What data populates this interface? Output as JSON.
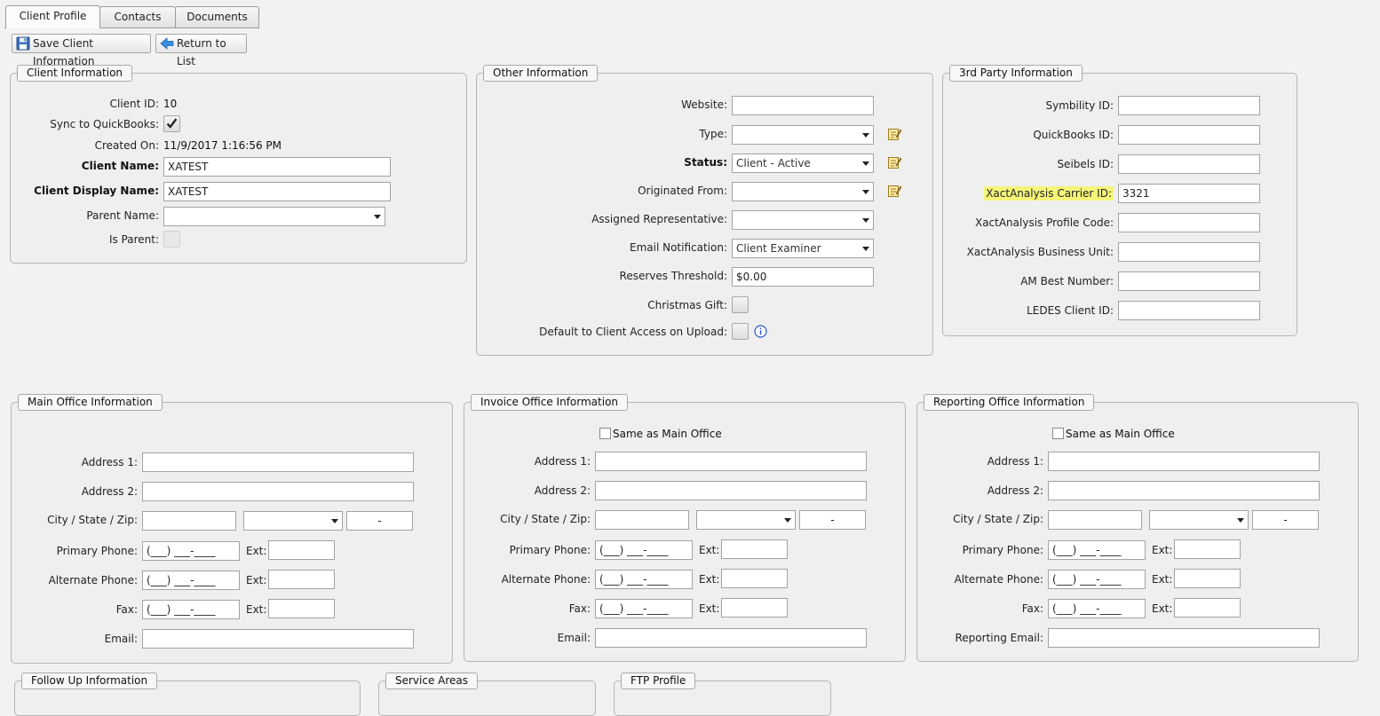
{
  "tabs": [
    {
      "label": "Client Profile",
      "active": true
    },
    {
      "label": "Contacts",
      "active": false
    },
    {
      "label": "Documents",
      "active": false
    }
  ],
  "toolbar": {
    "save_label": "Save Client Information",
    "return_label": "Return to List",
    "save_icon": "floppy-disk-icon",
    "return_icon": "back-arrow-icon"
  },
  "client_info": {
    "title": "Client Information",
    "client_id_label": "Client ID:",
    "client_id": "10",
    "sync_label": "Sync to QuickBooks:",
    "sync_checked": true,
    "created_label": "Created On:",
    "created_on": "11/9/2017 1:16:56 PM",
    "client_name_label": "Client Name:",
    "client_name": "XATEST",
    "display_name_label": "Client Display Name:",
    "display_name": "XATEST",
    "parent_label": "Parent Name:",
    "parent_value": "",
    "is_parent_label": "Is Parent:"
  },
  "other_info": {
    "title": "Other Information",
    "website_label": "Website:",
    "website": "",
    "type_label": "Type:",
    "type_value": "",
    "status_label": "Status:",
    "status_value": "Client - Active",
    "originated_label": "Originated From:",
    "originated_value": "",
    "rep_label": "Assigned Representative:",
    "rep_value": "",
    "email_notif_label": "Email Notification:",
    "email_notif_value": "Client Examiner",
    "reserves_label": "Reserves Threshold:",
    "reserves_value": "$0.00",
    "christmas_label": "Christmas Gift:",
    "default_access_label": "Default to Client Access on Upload:"
  },
  "third_party": {
    "title": "3rd Party Information",
    "fields": [
      {
        "label": "Symbility ID:",
        "value": "",
        "highlight": false
      },
      {
        "label": "QuickBooks ID:",
        "value": "",
        "highlight": false
      },
      {
        "label": "Seibels ID:",
        "value": "",
        "highlight": false
      },
      {
        "label": "XactAnalysis Carrier ID:",
        "value": "3321",
        "highlight": true
      },
      {
        "label": "XactAnalysis Profile Code:",
        "value": "",
        "highlight": false
      },
      {
        "label": "XactAnalysis Business Unit:",
        "value": "",
        "highlight": false
      },
      {
        "label": "AM Best Number:",
        "value": "",
        "highlight": false
      },
      {
        "label": "LEDES Client ID:",
        "value": "",
        "highlight": false
      }
    ],
    "highlight_color": "#f5f57a"
  },
  "main_office": {
    "title": "Main Office Information",
    "address1_label": "Address 1:",
    "address2_label": "Address 2:",
    "csz_label": "City / State / Zip:",
    "zip_mask": "-",
    "primary_label": "Primary Phone:",
    "alternate_label": "Alternate Phone:",
    "fax_label": "Fax:",
    "ext_label": "Ext:",
    "phone_mask": "(___) ___-____",
    "email_label": "Email:"
  },
  "invoice_office": {
    "title": "Invoice Office Information",
    "same_as_label": "Same as Main Office",
    "address1_label": "Address 1:",
    "address2_label": "Address 2:",
    "csz_label": "City / State / Zip:",
    "zip_mask": "-",
    "primary_label": "Primary Phone:",
    "alternate_label": "Alternate Phone:",
    "fax_label": "Fax:",
    "ext_label": "Ext:",
    "phone_mask": "(___) ___-____",
    "email_label": "Email:"
  },
  "reporting_office": {
    "title": "Reporting Office Information",
    "same_as_label": "Same as Main Office",
    "address1_label": "Address 1:",
    "address2_label": "Address 2:",
    "csz_label": "City / State / Zip:",
    "zip_mask": "-",
    "primary_label": "Primary Phone:",
    "alternate_label": "Alternate Phone:",
    "fax_label": "Fax:",
    "ext_label": "Ext:",
    "phone_mask": "(___) ___-____",
    "email_label": "Reporting Email:"
  },
  "bottom_groups": {
    "follow_up": "Follow Up Information",
    "service_areas": "Service Areas",
    "ftp_profile": "FTP Profile"
  }
}
